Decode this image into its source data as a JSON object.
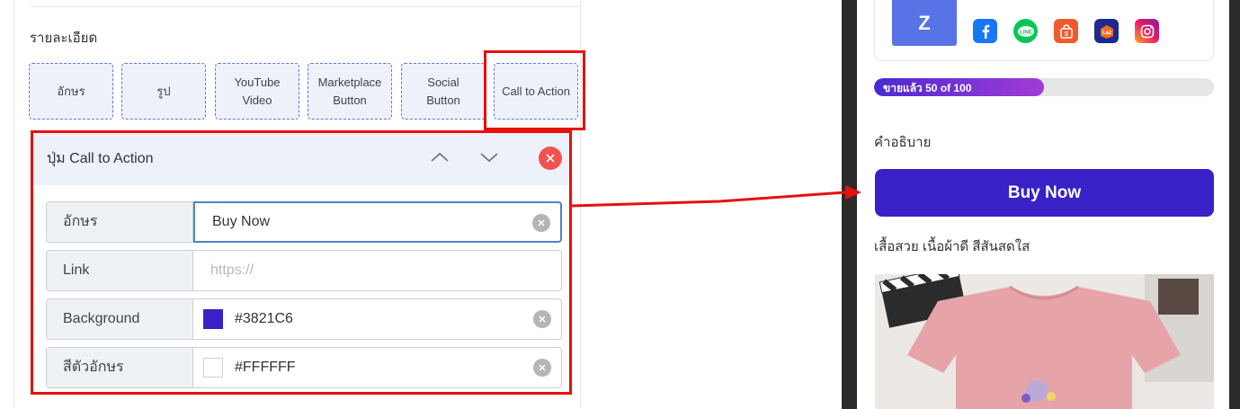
{
  "editor": {
    "section_title": "รายละเอียด",
    "types": [
      {
        "label": "อักษร"
      },
      {
        "label": "รูป"
      },
      {
        "label": "YouTube\nVideo"
      },
      {
        "label": "Marketplace\nButton"
      },
      {
        "label": "Social\nButton"
      },
      {
        "label": "Call to Action"
      }
    ],
    "panel": {
      "title": "ปุ่ม Call to Action",
      "fields": {
        "text": {
          "label": "อักษร",
          "value": "Buy Now"
        },
        "link": {
          "label": "Link",
          "placeholder": "https://"
        },
        "background": {
          "label": "Background",
          "value": "#3821C6"
        },
        "text_color": {
          "label": "สีตัวอักษร",
          "value": "#FFFFFF"
        }
      }
    }
  },
  "preview": {
    "avatar_letter": "Z",
    "social_icons": [
      "facebook-icon",
      "line-icon",
      "shopee-icon",
      "lazada-icon",
      "instagram-icon"
    ],
    "progress": {
      "label": "ขายแล้ว 50 of 100",
      "sold": 50,
      "total": 100
    },
    "description_title": "คำอธิบาย",
    "cta_label": "Buy Now",
    "product_text": "เสื้อสวย เนื้อผ้าดี สีสันสดใส"
  },
  "colors": {
    "cta_background": "#3821C6",
    "cta_text": "#FFFFFF",
    "highlight": "#E80F0F",
    "close_button": "#EF5350"
  }
}
